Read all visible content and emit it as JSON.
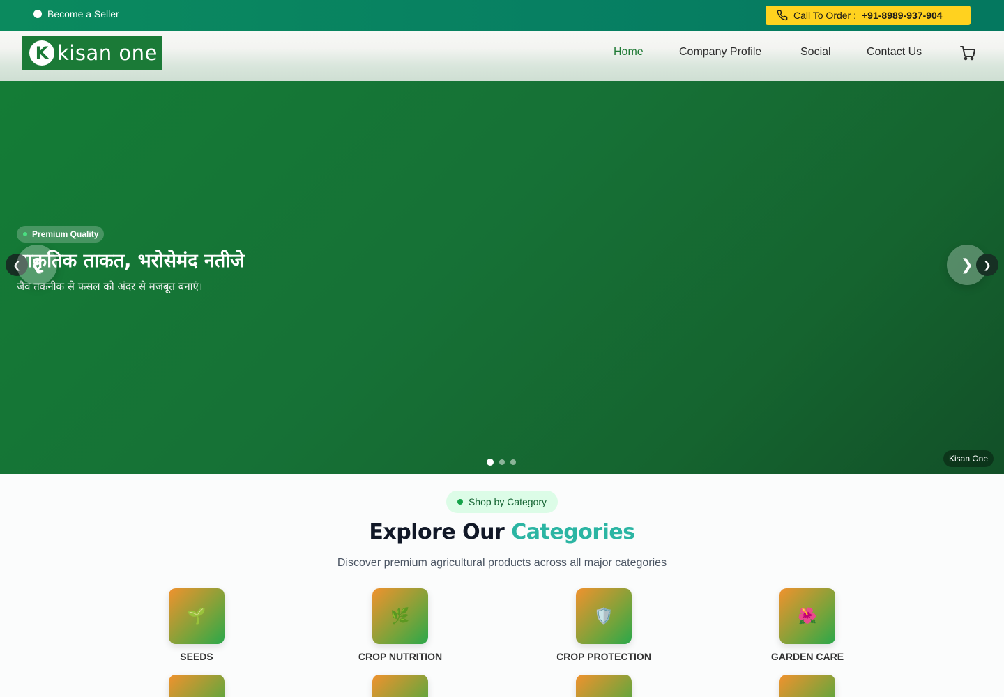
{
  "topbar": {
    "seller_label": "Become a Seller",
    "call_label": "Call To Order :",
    "call_number": "+91-8989-937-904"
  },
  "header": {
    "logo_mark": "K",
    "logo_text": "kisan one",
    "nav": [
      {
        "label": "Home",
        "active": true
      },
      {
        "label": "Company Profile",
        "active": false
      },
      {
        "label": "Social",
        "active": false
      },
      {
        "label": "Contact Us",
        "active": false
      }
    ],
    "cart_icon": "shopping-cart-icon"
  },
  "hero": {
    "badge": "Premium Quality",
    "headline": "प्राकृतिक ताकत, भरोसेमंद नतीजे",
    "subline": "जैव तकनीक से फसल को अंदर से मजबूत बनाएं।",
    "prev_icon": "chevron-left-icon",
    "next_icon": "chevron-right-icon",
    "slide_count": 3,
    "active_slide": 1,
    "watermark": "Kisan One"
  },
  "categories": {
    "pill": "Shop by Category",
    "title_part1": "Explore Our",
    "title_part2": "Categories",
    "subtitle": "Discover premium agricultural products across all major categories",
    "items": [
      {
        "label": "SEEDS",
        "icon": "🌱"
      },
      {
        "label": "CROP NUTRITION",
        "icon": "🌿"
      },
      {
        "label": "CROP PROTECTION",
        "icon": "🛡️"
      },
      {
        "label": "GARDEN CARE",
        "icon": "🌺"
      }
    ]
  },
  "colors": {
    "brand_green": "#1b7a37",
    "topbar_teal": "#078062",
    "call_yellow": "#ffd21f",
    "accent_teal": "#2bb5a3"
  }
}
